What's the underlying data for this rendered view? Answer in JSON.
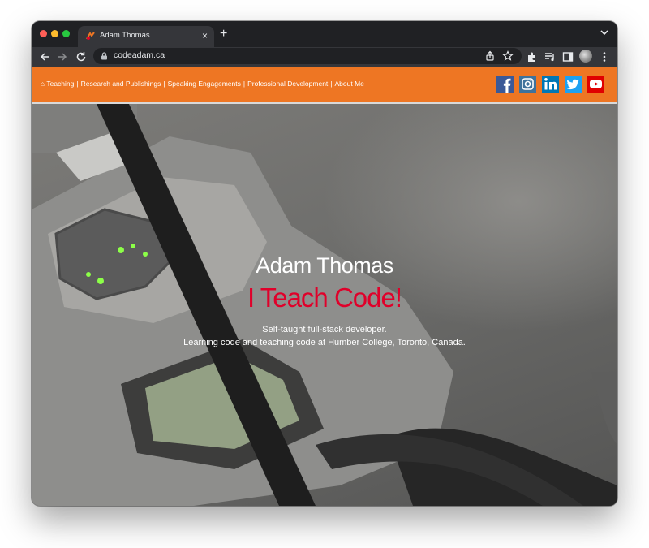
{
  "browser": {
    "tab_title": "Adam Thomas",
    "new_tab_symbol": "+",
    "tab_close_symbol": "×",
    "url": "codeadam.ca"
  },
  "nav": {
    "links": [
      {
        "label": "⌂ Teaching"
      },
      {
        "label": "Research and Publishings"
      },
      {
        "label": "Speaking Engagements"
      },
      {
        "label": "Professional Development"
      },
      {
        "label": "About Me"
      }
    ],
    "separator": "|",
    "background_color": "#ee7623",
    "social_icons": [
      "facebook-icon",
      "instagram-icon",
      "linkedin-icon",
      "twitter-icon",
      "youtube-icon"
    ]
  },
  "hero": {
    "name": "Adam Thomas",
    "tagline": "I Teach Code!",
    "tagline_color": "#e0002a",
    "subtitle_line1": "Self-taught full-stack developer.",
    "subtitle_line2": "Learning code and teaching code at Humber College, Toronto, Canada."
  }
}
